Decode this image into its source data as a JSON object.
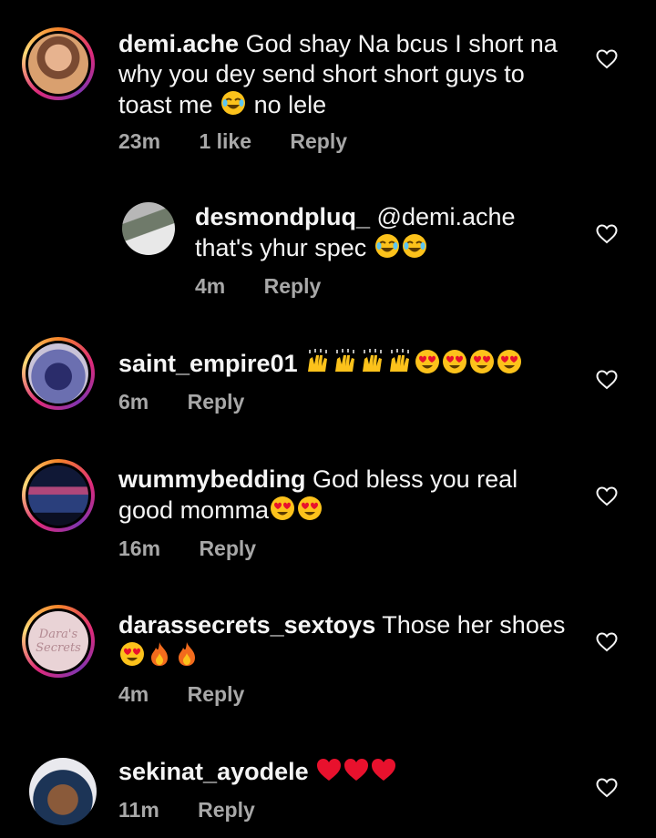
{
  "comments": [
    {
      "username": "demi.ache",
      "text": "God shay Na bcus I short na why you dey send short short guys to toast me",
      "emoji_after": "laughing-emoji",
      "text_end": "no lele",
      "time": "23m",
      "likes": "1 like",
      "reply_label": "Reply"
    },
    {
      "username": "desmondpluq_",
      "text": "@demi.ache that's yhur spec",
      "time": "4m",
      "reply_label": "Reply"
    },
    {
      "username": "saint_empire01",
      "text": "",
      "time": "6m",
      "reply_label": "Reply"
    },
    {
      "username": "wummybedding",
      "text": "God bless you real good momma",
      "time": "16m",
      "reply_label": "Reply"
    },
    {
      "username": "darassecrets_sextoys",
      "text": "Those her shoes",
      "avatar_text": "Dara's Secrets",
      "time": "4m",
      "reply_label": "Reply"
    },
    {
      "username": "sekinat_ayodele",
      "text": "",
      "time": "11m",
      "reply_label": "Reply"
    }
  ],
  "colors": {
    "background": "#000000",
    "text": "#f5f5f5",
    "meta": "#a8a8a8"
  }
}
